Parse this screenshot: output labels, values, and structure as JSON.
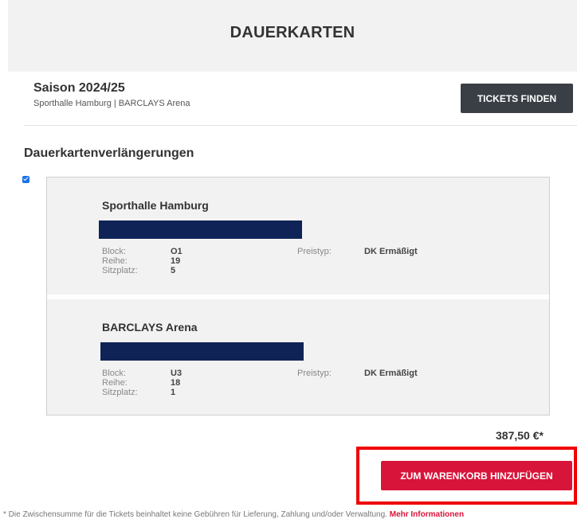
{
  "header": {
    "title": "DAUERKARTEN"
  },
  "season": {
    "title": "Saison 2024/25",
    "subtitle": "Sporthalle Hamburg | BARCLAYS Arena",
    "find_button": "TICKETS FINDEN"
  },
  "renewals": {
    "title": "Dauerkartenverlängerungen",
    "checked": true,
    "items": [
      {
        "venue": "Sporthalle Hamburg",
        "block_label": "Block:",
        "block": "O1",
        "row_label": "Reihe:",
        "row": "19",
        "seat_label": "Sitzplatz:",
        "seat": "5",
        "price_type_label": "Preistyp:",
        "price_type": "DK Ermäßigt"
      },
      {
        "venue": "BARCLAYS Arena",
        "block_label": "Block:",
        "block": "U3",
        "row_label": "Reihe:",
        "row": "18",
        "seat_label": "Sitzplatz:",
        "seat": "1",
        "price_type_label": "Preistyp:",
        "price_type": "DK Ermäßigt"
      }
    ]
  },
  "total": "387,50 €*",
  "cart_button": "ZUM WARENKORB HINZUFÜGEN",
  "footnote": {
    "text": "* Die Zwischensumme für die Tickets beinhaltet keine Gebühren für Lieferung, Zahlung und/oder Verwaltung.",
    "link": "Mehr Informationen"
  },
  "colors": {
    "header_bg": "#f2f2f2",
    "dark_button": "#3a3f45",
    "accent_red": "#d8143a",
    "redaction": "#0f2356",
    "highlight": "#f00000",
    "checkbox": "#1a73e8"
  }
}
